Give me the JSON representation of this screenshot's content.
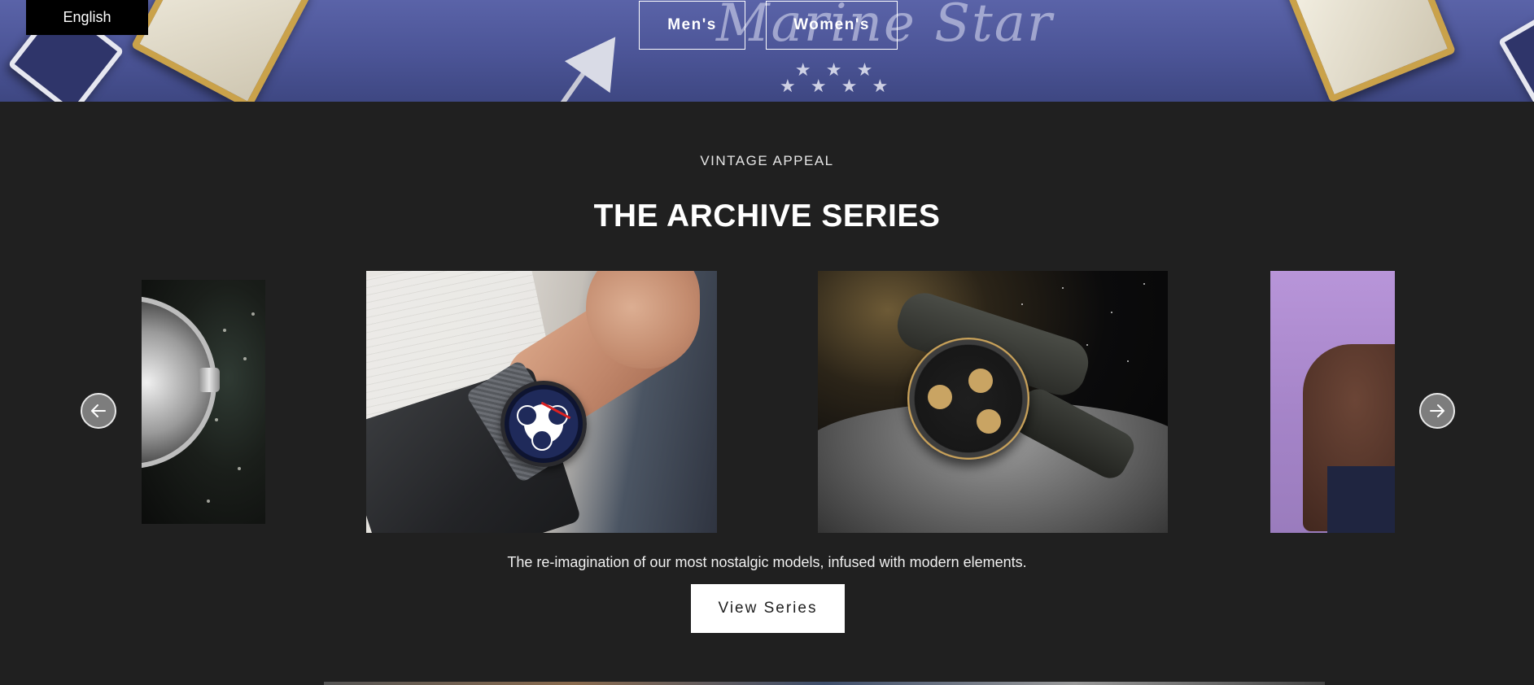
{
  "language_selector": {
    "label": "English"
  },
  "hero": {
    "buttons": {
      "men": "Men's",
      "women": "Women's"
    },
    "dial_text": "Marine Star",
    "stars": "★ ★ ★\n★ ★ ★ ★"
  },
  "section": {
    "eyebrow": "VINTAGE APPEAL",
    "title": "THE ARCHIVE SERIES",
    "description": "The re-imagination of our most nostalgic models, infused with modern elements.",
    "cta_label": "View Series"
  },
  "carousel": {
    "slides": [
      {
        "subject": "watch in space (partially visible)"
      },
      {
        "subject": "blue chronograph watch on wrist"
      },
      {
        "subject": "gold and steel chronograph on moon surface"
      },
      {
        "subject": "hand with purple shirt (partially visible)"
      }
    ],
    "prev_icon": "arrow-left-icon",
    "next_icon": "arrow-right-icon"
  },
  "colors": {
    "page_background": "#202020",
    "hero_blue": "#4b5496",
    "cta_background": "#ffffff",
    "language_tab": "#000000"
  }
}
